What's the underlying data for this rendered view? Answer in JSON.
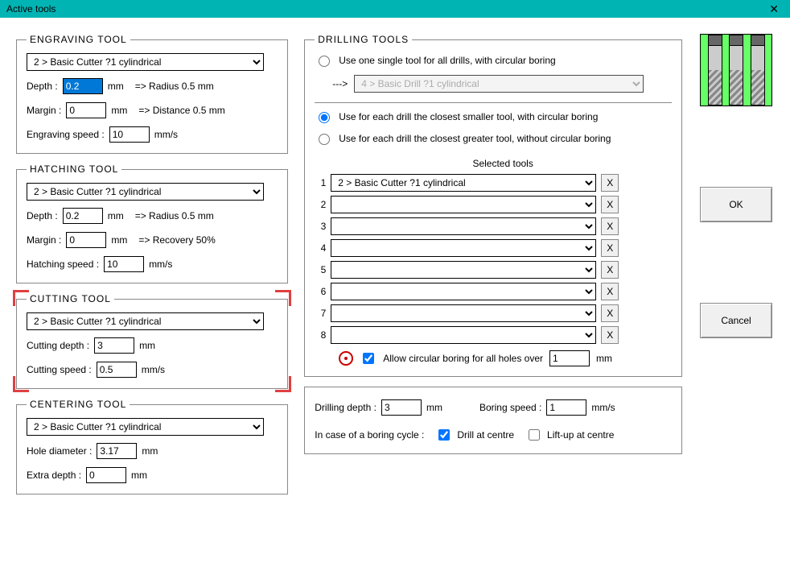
{
  "window": {
    "title": "Active tools"
  },
  "engraving": {
    "legend": "ENGRAVING  TOOL",
    "tool": "2 > Basic Cutter   ?1   cylindrical",
    "depth_label": "Depth :",
    "depth": "0.2",
    "depth_unit": "mm",
    "depth_info": "=> Radius 0.5 mm",
    "margin_label": "Margin :",
    "margin": "0",
    "margin_unit": "mm",
    "margin_info": "=> Distance 0.5 mm",
    "speed_label": "Engraving speed :",
    "speed": "10",
    "speed_unit": "mm/s"
  },
  "hatching": {
    "legend": "HATCHING  TOOL",
    "tool": "2 > Basic Cutter   ?1   cylindrical",
    "depth_label": "Depth :",
    "depth": "0.2",
    "depth_unit": "mm",
    "depth_info": "=> Radius 0.5 mm",
    "margin_label": "Margin :",
    "margin": "0",
    "margin_unit": "mm",
    "margin_info": "=> Recovery 50%",
    "speed_label": "Hatching speed :",
    "speed": "10",
    "speed_unit": "mm/s"
  },
  "cutting": {
    "legend": "CUTTING  TOOL",
    "tool": "2 > Basic Cutter   ?1   cylindrical",
    "depth_label": "Cutting depth :",
    "depth": "3",
    "depth_unit": "mm",
    "speed_label": "Cutting speed :",
    "speed": "0.5",
    "speed_unit": "mm/s"
  },
  "centering": {
    "legend": "CENTERING  TOOL",
    "tool": "2 > Basic Cutter   ?1   cylindrical",
    "diameter_label": "Hole diameter :",
    "diameter": "3.17",
    "diameter_unit": "mm",
    "extra_label": "Extra depth :",
    "extra": "0",
    "extra_unit": "mm"
  },
  "drilling": {
    "legend": "DRILLING  TOOLS",
    "opt1": "Use one single tool for all drills, with circular boring",
    "arrow": "--->",
    "single_tool": "4 > Basic Drill   ?1   cylindrical",
    "opt2": "Use for each drill the closest smaller tool, with circular boring",
    "opt3": "Use for each drill the closest greater tool, without circular boring",
    "selected_header": "Selected tools",
    "rows": [
      {
        "n": "1",
        "val": "2 > Basic Cutter   ?1   cylindrical"
      },
      {
        "n": "2",
        "val": ""
      },
      {
        "n": "3",
        "val": ""
      },
      {
        "n": "4",
        "val": ""
      },
      {
        "n": "5",
        "val": ""
      },
      {
        "n": "6",
        "val": ""
      },
      {
        "n": "7",
        "val": ""
      },
      {
        "n": "8",
        "val": ""
      }
    ],
    "x": "X",
    "allow_label": "Allow circular boring for all holes over",
    "allow_val": "1",
    "allow_unit": "mm",
    "allow_checked": true,
    "depth_label": "Drilling depth :",
    "depth": "3",
    "depth_unit": "mm",
    "bspeed_label": "Boring speed :",
    "bspeed": "1",
    "bspeed_unit": "mm/s",
    "cycle_label": "In case of a boring cycle :",
    "drill_centre_label": "Drill at centre",
    "drill_centre_checked": true,
    "lift_label": "Lift-up at centre",
    "lift_checked": false
  },
  "buttons": {
    "ok": "OK",
    "cancel": "Cancel"
  }
}
